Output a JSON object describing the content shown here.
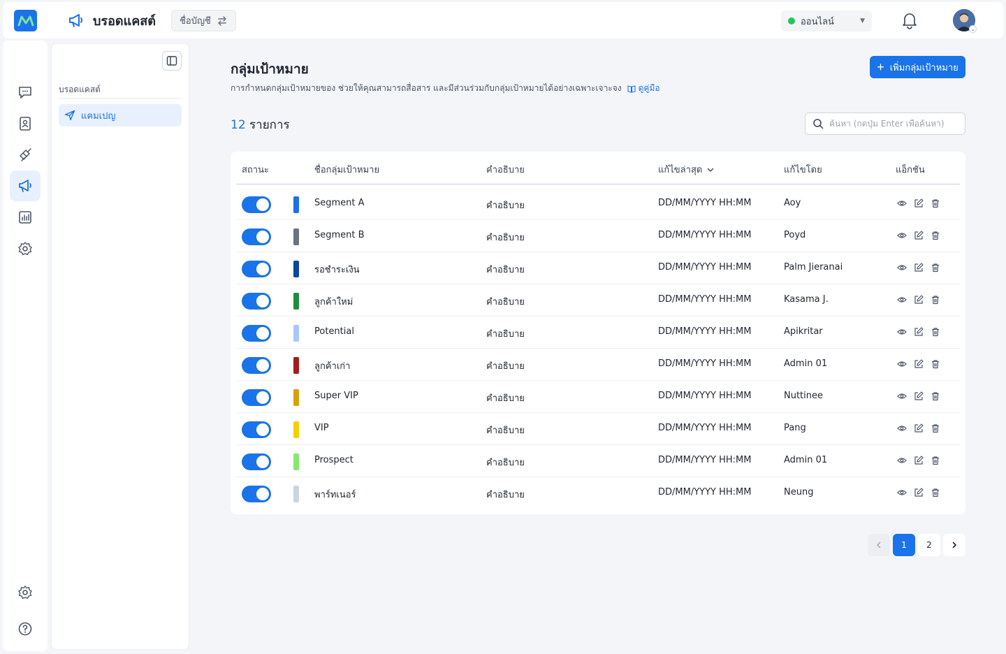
{
  "header": {
    "title": "บรอดแคสต์",
    "account_chip": "ชื่อบัญชี",
    "status": "ออนไลน์"
  },
  "colors": {
    "accent": "#1a73e8",
    "online": "#22c55e"
  },
  "rail": {
    "items": [
      "chat-icon",
      "contacts-icon",
      "integration-icon",
      "broadcast-icon",
      "report-icon",
      "settings-icon"
    ],
    "bottom": [
      "settings-icon",
      "help-icon"
    ],
    "active_index": 3
  },
  "sidemenu": {
    "heading": "บรอดแคสต์",
    "items": [
      {
        "label": "แคมเปญ",
        "icon": "send-icon",
        "active": true
      }
    ]
  },
  "main": {
    "title": "กลุ่มเป้าหมาย",
    "description": "การกำหนดกลุ่มเป้าหมายของ ช่วยให้คุณสามารถสื่อสาร และมีส่วนร่วมกับกลุ่มเป้าหมายได้อย่างเฉพาะเจาะจง",
    "guide_link": "ดูคู่มือ",
    "add_button": "เพิ่มกลุ่มเป้าหมาย",
    "count_num": "12",
    "count_label": "รายการ",
    "search_placeholder": "ค้นหา (กดปุ่ม Enter เพื่อค้นหา)"
  },
  "table": {
    "columns": [
      "สถานะ",
      "ชื่อกลุ่มเป้าหมาย",
      "คำอธิบาย",
      "แก้ไขล่าสุด",
      "แก้ไขโดย",
      "แอ็กชัน"
    ],
    "rows": [
      {
        "enabled": true,
        "color": "#1a73e8",
        "name": "Segment A",
        "desc": "คำอธิบาย",
        "updated": "DD/MM/YYYY HH:MM",
        "by": "Aoy"
      },
      {
        "enabled": true,
        "color": "#6b7280",
        "name": "Segment B",
        "desc": "คำอธิบาย",
        "updated": "DD/MM/YYYY HH:MM",
        "by": "Poyd"
      },
      {
        "enabled": true,
        "color": "#0d47a1",
        "name": "รอชำระเงิน",
        "desc": "คำอธิบาย",
        "updated": "DD/MM/YYYY HH:MM",
        "by": "Palm Jieranai"
      },
      {
        "enabled": true,
        "color": "#1e8e3e",
        "name": "ลูกค้าใหม่",
        "desc": "คำอธิบาย",
        "updated": "DD/MM/YYYY HH:MM",
        "by": "Kasama J."
      },
      {
        "enabled": true,
        "color": "#a8c7fa",
        "name": "Potential",
        "desc": "คำอธิบาย",
        "updated": "DD/MM/YYYY HH:MM",
        "by": "Apikritar"
      },
      {
        "enabled": true,
        "color": "#a51c1c",
        "name": "ลูกค้าเก่า",
        "desc": "คำอธิบาย",
        "updated": "DD/MM/YYYY HH:MM",
        "by": "Admin 01"
      },
      {
        "enabled": true,
        "color": "#d4a20a",
        "name": "Super VIP",
        "desc": "คำอธิบาย",
        "updated": "DD/MM/YYYY HH:MM",
        "by": "Nuttinee"
      },
      {
        "enabled": true,
        "color": "#f5d000",
        "name": "VIP",
        "desc": "คำอธิบาย",
        "updated": "DD/MM/YYYY HH:MM",
        "by": "Pang"
      },
      {
        "enabled": true,
        "color": "#86e86e",
        "name": "Prospect",
        "desc": "คำอธิบาย",
        "updated": "DD/MM/YYYY HH:MM",
        "by": "Admin 01"
      },
      {
        "enabled": true,
        "color": "#cbd5e1",
        "name": "พาร์ทเนอร์",
        "desc": "คำอธิบาย",
        "updated": "DD/MM/YYYY HH:MM",
        "by": "Neung"
      }
    ]
  },
  "pagination": {
    "pages": [
      "1",
      "2"
    ],
    "current": "1"
  }
}
